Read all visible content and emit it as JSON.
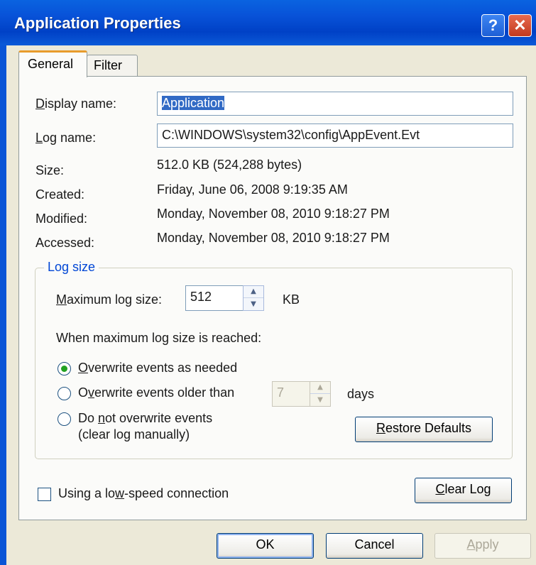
{
  "window": {
    "title": "Application Properties",
    "help_label": "?",
    "close_label": "✕"
  },
  "tabs": [
    {
      "label": "General"
    },
    {
      "label": "Filter"
    }
  ],
  "fields": {
    "display_name": {
      "label_u": "D",
      "label_rest": "isplay name:",
      "value": "Application"
    },
    "log_name": {
      "label_u": "L",
      "label_rest": "og name:",
      "value": "C:\\WINDOWS\\system32\\config\\AppEvent.Evt"
    },
    "size": {
      "label": "Size:",
      "value": "512.0 KB (524,288 bytes)"
    },
    "created": {
      "label": "Created:",
      "value": "Friday, June 06, 2008 9:19:35 AM"
    },
    "modified": {
      "label": "Modified:",
      "value": "Monday, November 08, 2010 9:18:27 PM"
    },
    "accessed": {
      "label": "Accessed:",
      "value": "Monday, November 08, 2010 9:18:27 PM"
    }
  },
  "log_size": {
    "group_title": "Log size",
    "max_label_u": "M",
    "max_label_rest": "aximum log size:",
    "max_value": "512",
    "unit": "KB",
    "when_reached": "When maximum log size is reached:",
    "options": [
      {
        "pre": "",
        "u": "O",
        "post": "verwrite events as needed",
        "selected": true
      },
      {
        "pre": "O",
        "u": "v",
        "post": "erwrite events older than",
        "selected": false
      },
      {
        "pre": "Do ",
        "u": "n",
        "post": "ot overwrite events",
        "selected": false
      }
    ],
    "option3_line2": "(clear log manually)",
    "days_value": "7",
    "days_label": "days",
    "restore_u": "R",
    "restore_rest": "estore Defaults"
  },
  "low_speed": {
    "pre": "Using a lo",
    "u": "w",
    "post": "-speed connection",
    "checked": false
  },
  "clear_log": {
    "u": "C",
    "rest": "lear Log"
  },
  "buttons": {
    "ok": "OK",
    "cancel": "Cancel",
    "apply_u": "A",
    "apply_rest": "pply"
  },
  "colors": {
    "titlebar": "#0a55d6",
    "selection": "#316ac5",
    "radio_selected": "#21a121",
    "group_title": "#0046d5"
  }
}
